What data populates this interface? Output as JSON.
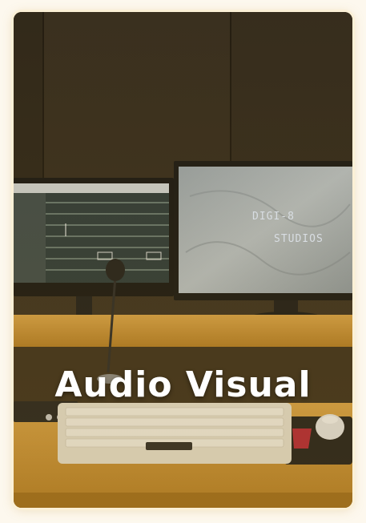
{
  "card": {
    "title": "Audio Visual",
    "monitor_logo_line1": "DIGI-8",
    "monitor_logo_line2": "STUDIOS"
  },
  "colors": {
    "title": "#ffffff",
    "panel": "#2d251b",
    "wood": "#c8902f",
    "screen": "#aab4bb"
  }
}
